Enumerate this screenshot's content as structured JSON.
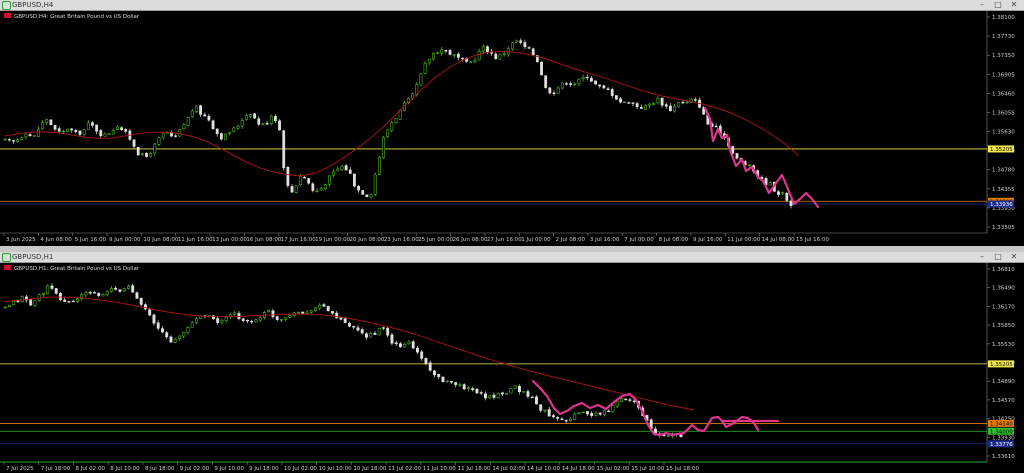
{
  "windows": [
    {
      "title": "GBPUSD,H4",
      "chart_label": "GBPUSD,H4:  Great Britain Pound vs US Dollar",
      "chart_data": {
        "type": "candlestick",
        "symbol": "GBPUSD",
        "timeframe": "H4",
        "description": "Great Britain Pound vs US Dollar",
        "y_ticks": [
          "1.38100",
          "1.37730",
          "1.37350",
          "1.36905",
          "1.36460",
          "1.36055",
          "1.35630",
          "1.35180",
          "1.34780",
          "1.34355",
          "1.33930",
          "1.33505"
        ],
        "ylim": [
          1.3327,
          1.3838
        ],
        "x_ticks": [
          "3 Jun 2025",
          "4 Jun 08:00",
          "5 Jun 16:00",
          "9 Jun 00:00",
          "10 Jun 08:00",
          "11 Jun 16:00",
          "13 Jun 00:00",
          "16 Jun 08:00",
          "17 Jun 16:00",
          "19 Jun 00:00",
          "20 Jun 08:00",
          "23 Jun 16:00",
          "25 Jun 00:00",
          "26 Jun 08:00",
          "27 Jun 16:00",
          "1 Jul 00:00",
          "2 Jul 08:00",
          "3 Jul 16:00",
          "7 Jul 00:00",
          "8 Jul 08:00",
          "9 Jul 16:00",
          "11 Jul 00:00",
          "14 Jul 08:00",
          "15 Jul 16:00"
        ],
        "close_path": [
          1.354,
          1.3535,
          1.3545,
          1.356,
          1.3545,
          1.3575,
          1.359,
          1.3565,
          1.3555,
          1.357,
          1.3555,
          1.356,
          1.358,
          1.3565,
          1.355,
          1.356,
          1.3575,
          1.356,
          1.354,
          1.351,
          1.35,
          1.352,
          1.3545,
          1.356,
          1.354,
          1.3565,
          1.359,
          1.362,
          1.36,
          1.359,
          1.356,
          1.3545,
          1.356,
          1.357,
          1.3595,
          1.3605,
          1.358,
          1.3575,
          1.36,
          1.358,
          1.344,
          1.342,
          1.346,
          1.345,
          1.342,
          1.343,
          1.345,
          1.347,
          1.348,
          1.347,
          1.343,
          1.342,
          1.341,
          1.348,
          1.355,
          1.358,
          1.36,
          1.3625,
          1.364,
          1.368,
          1.372,
          1.374,
          1.375,
          1.3745,
          1.3735,
          1.3725,
          1.3715,
          1.373,
          1.3755,
          1.3745,
          1.373,
          1.374,
          1.376,
          1.377,
          1.3755,
          1.3745,
          1.372,
          1.366,
          1.365,
          1.3665,
          1.3675,
          1.367,
          1.368,
          1.369,
          1.367,
          1.366,
          1.3655,
          1.364,
          1.3625,
          1.363,
          1.362,
          1.3615,
          1.3625,
          1.3635,
          1.362,
          1.361,
          1.363,
          1.3625,
          1.3635,
          1.362,
          1.358,
          1.357,
          1.356,
          1.3535,
          1.35,
          1.349,
          1.348,
          1.3465,
          1.3445,
          1.344,
          1.342,
          1.3415,
          1.339
        ],
        "moving_average": [
          1.355,
          1.3556,
          1.356,
          1.356,
          1.3555,
          1.3548,
          1.3545,
          1.3546,
          1.3552,
          1.3558,
          1.356,
          1.3558,
          1.355,
          1.3538,
          1.352,
          1.35,
          1.3482,
          1.347,
          1.3462,
          1.3458,
          1.3465,
          1.3482,
          1.3505,
          1.353,
          1.356,
          1.3595,
          1.363,
          1.3665,
          1.3695,
          1.3718,
          1.3734,
          1.3743,
          1.3745,
          1.3742,
          1.3736,
          1.3725,
          1.3712,
          1.37,
          1.369,
          1.3678,
          1.3666,
          1.3654,
          1.3644,
          1.3636,
          1.363,
          1.3622,
          1.3612,
          1.3598,
          1.358,
          1.356,
          1.3535,
          1.3505
        ],
        "horizontal_levels": [
          {
            "name": "yellow",
            "price": "1.35205",
            "color": "#f2e94e"
          },
          {
            "name": "orange",
            "price": "1.34000",
            "color": "#e07b00"
          },
          {
            "name": "navy",
            "price": "1.33936",
            "color": "#1a2a8a"
          }
        ],
        "projection": "magenta hand-drawn path descending then bouncing near 1.3400",
        "colors": {
          "bull": "#5ad41a",
          "bear": "#e0e0e0",
          "ma": "#b01414",
          "grid": "#222",
          "projection": "#e0338c"
        }
      }
    },
    {
      "title": "GBPUSD,H1",
      "chart_label": "GBPUSD,H1:  Great Britain Pound vs US Dollar",
      "chart_data": {
        "type": "candlestick",
        "symbol": "GBPUSD",
        "timeframe": "H1",
        "description": "Great Britain Pound vs US Dollar",
        "y_ticks": [
          "1.36810",
          "1.36490",
          "1.36170",
          "1.35850",
          "1.35530",
          "1.35210",
          "1.34890",
          "1.34570",
          "1.34250",
          "1.33930",
          "1.33610"
        ],
        "ylim": [
          1.3345,
          1.3701
        ],
        "x_ticks": [
          "7 Jul 2025",
          "7 Jul 18:00",
          "8 Jul 02:00",
          "8 Jul 10:00",
          "8 Jul 18:00",
          "9 Jul 02:00",
          "9 Jul 10:00",
          "9 Jul 18:00",
          "10 Jul 02:00",
          "10 Jul 10:00",
          "10 Jul 18:00",
          "11 Jul 02:00",
          "11 Jul 10:00",
          "11 Jul 18:00",
          "14 Jul 02:00",
          "14 Jul 10:00",
          "14 Jul 18:00",
          "15 Jul 02:00",
          "15 Jul 10:00",
          "15 Jul 18:00"
        ],
        "close_path": [
          1.362,
          1.363,
          1.364,
          1.3625,
          1.3645,
          1.366,
          1.364,
          1.363,
          1.3635,
          1.3645,
          1.365,
          1.364,
          1.3655,
          1.365,
          1.366,
          1.364,
          1.362,
          1.359,
          1.3575,
          1.356,
          1.357,
          1.359,
          1.3605,
          1.361,
          1.3595,
          1.36,
          1.361,
          1.36,
          1.3595,
          1.3605,
          1.3615,
          1.36,
          1.3605,
          1.3615,
          1.361,
          1.362,
          1.3625,
          1.3615,
          1.36,
          1.359,
          1.358,
          1.357,
          1.3575,
          1.3585,
          1.356,
          1.355,
          1.356,
          1.354,
          1.352,
          1.35,
          1.3485,
          1.349,
          1.348,
          1.3475,
          1.347,
          1.346,
          1.3465,
          1.347,
          1.348,
          1.347,
          1.346,
          1.344,
          1.343,
          1.3425,
          1.342,
          1.343,
          1.3435,
          1.3428,
          1.3432,
          1.344,
          1.3455,
          1.346,
          1.345,
          1.342,
          1.3395,
          1.339,
          1.3395,
          1.3393
        ],
        "moving_average": [
          1.3632,
          1.3636,
          1.364,
          1.364,
          1.3636,
          1.363,
          1.3622,
          1.3614,
          1.3608,
          1.3605,
          1.3605,
          1.3607,
          1.3609,
          1.361,
          1.3608,
          1.3602,
          1.3594,
          1.3584,
          1.3572,
          1.3558,
          1.3544,
          1.353,
          1.3518,
          1.3506,
          1.3496,
          1.3486,
          1.3476,
          1.3466,
          1.3456,
          1.3446,
          1.3438
        ],
        "horizontal_levels": [
          {
            "name": "yellow",
            "price": "1.35205",
            "color": "#f2e94e"
          },
          {
            "name": "orange",
            "price": "1.34140",
            "color": "#e07b00"
          },
          {
            "name": "green",
            "price": "1.34000",
            "color": "#2ec02e"
          },
          {
            "name": "navy",
            "price": "1.33776",
            "color": "#1a2a8a"
          },
          {
            "name": "bottom",
            "price": "1.33450",
            "color": "#2ec02e"
          }
        ],
        "projection": "magenta path: drop, consolidation, then wavy sideways near 1.3420",
        "colors": {
          "bull": "#5ad41a",
          "bear": "#e0e0e0",
          "ma": "#b01414",
          "grid": "#222",
          "projection": "#e0338c"
        }
      }
    }
  ]
}
